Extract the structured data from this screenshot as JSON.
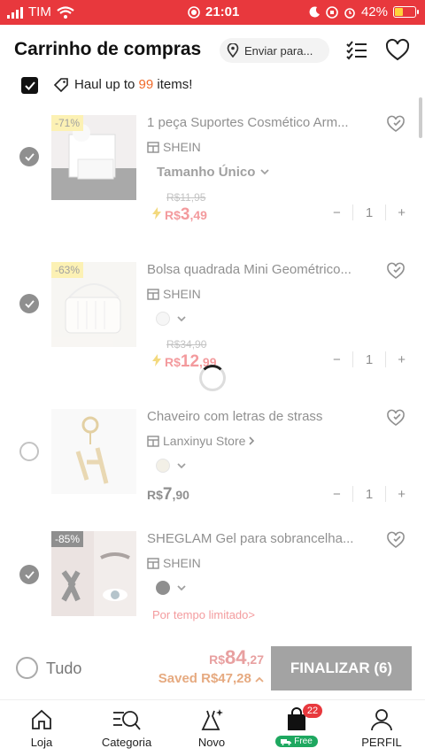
{
  "status_bar": {
    "carrier": "TIM",
    "time": "21:01",
    "battery": "42%"
  },
  "header": {
    "title": "Carrinho de compras",
    "ship_label": "Enviar para..."
  },
  "haul": {
    "prefix": "Haul up to ",
    "count": "99",
    "suffix": " items!"
  },
  "items": [
    {
      "name": "1 peça  Suportes Cosmético Arm...",
      "store": "SHEIN",
      "variant": "Tamanho Único",
      "old_price": "R$11,95",
      "currency": "R$",
      "price_int": "3",
      "price_dec": ",49",
      "discount": "-71%",
      "qty": "1",
      "selected": true
    },
    {
      "name": "Bolsa quadrada Mini Geométrico...",
      "store": "SHEIN",
      "old_price": "R$34,90",
      "currency": "R$",
      "price_int": "12",
      "price_dec": ",99",
      "discount": "-63%",
      "qty": "1",
      "selected": true
    },
    {
      "name": "Chaveiro com letras de strass",
      "store": "Lanxinyu Store",
      "currency": "R$",
      "price_int": "7",
      "price_dec": ",90",
      "qty": "1",
      "selected": false
    },
    {
      "name": "SHEGLAM Gel para sobrancelha...",
      "store": "SHEIN",
      "discount": "-85%",
      "limited": "Por tempo limitado>",
      "selected": true
    }
  ],
  "checkout": {
    "select_all": "Tudo",
    "total_currency": "R$",
    "total_int": "84",
    "total_dec": ",27",
    "saved": "Saved R$47,28",
    "button": "FINALIZAR (6)"
  },
  "tabs": [
    {
      "label": "Loja"
    },
    {
      "label": "Categoria"
    },
    {
      "label": "Novo"
    },
    {
      "badge": "22",
      "free": "Free"
    },
    {
      "label": "PERFIL"
    }
  ],
  "colors": {
    "brand_red": "#e8383d",
    "finalize_gray": "#a3a3a3",
    "free_green": "#1ea860"
  }
}
